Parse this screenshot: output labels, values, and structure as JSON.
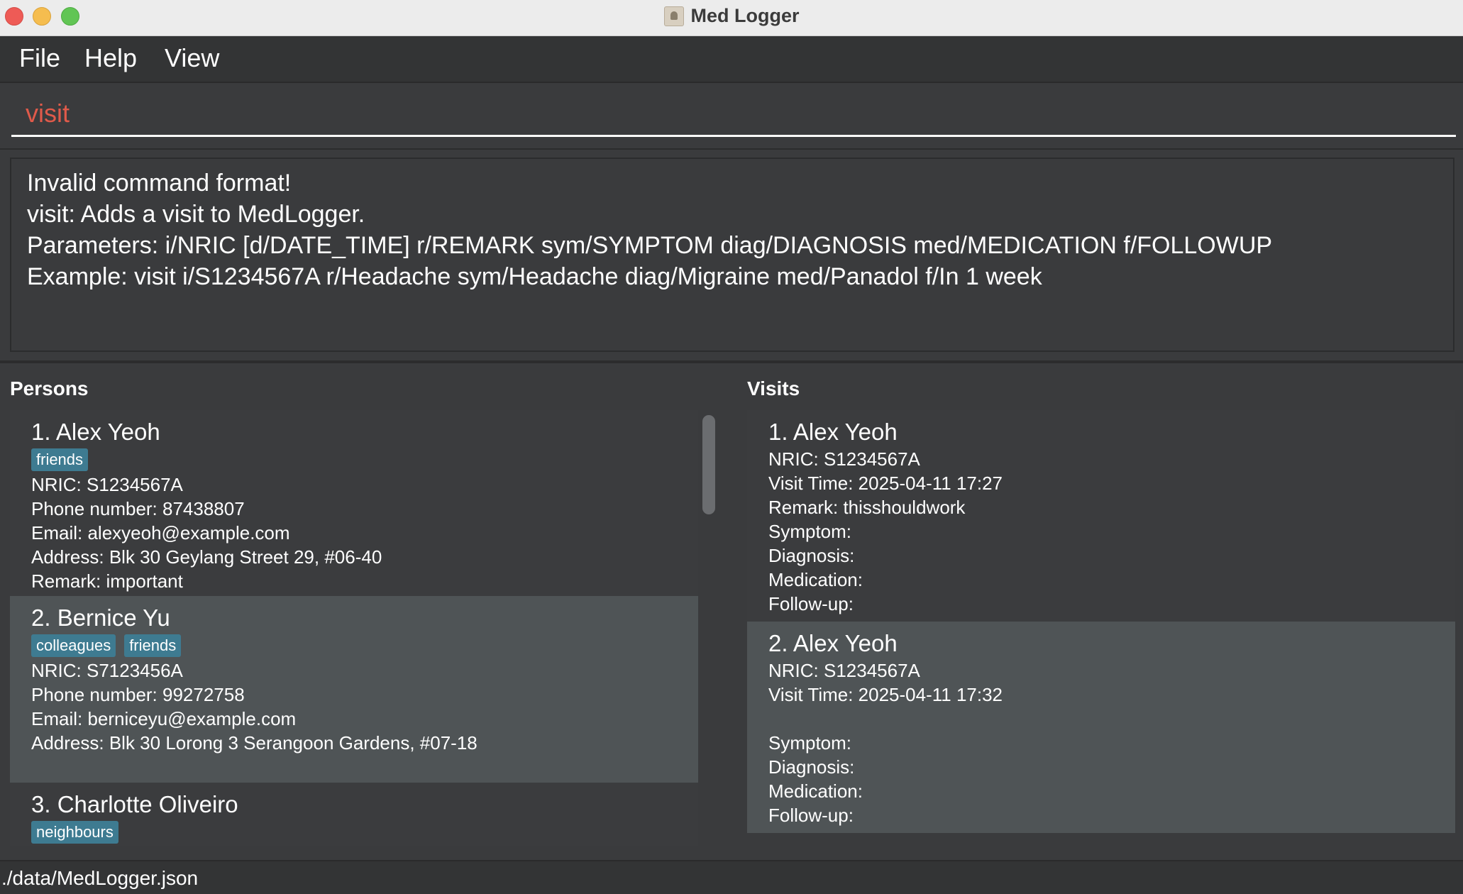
{
  "window": {
    "title": "Med Logger"
  },
  "menu": [
    "File",
    "Help",
    "View"
  ],
  "command": {
    "value": "visit"
  },
  "result": {
    "lines": [
      "Invalid command format!",
      "visit: Adds a visit to MedLogger.",
      "Parameters: i/NRIC [d/DATE_TIME] r/REMARK sym/SYMPTOM diag/DIAGNOSIS med/MEDICATION f/FOLLOWUP",
      "Example: visit i/S1234567A r/Headache sym/Headache diag/Migraine med/Panadol f/In 1 week"
    ]
  },
  "persons": {
    "title": "Persons",
    "items": [
      {
        "name": "1. Alex Yeoh",
        "tags": [
          "friends"
        ],
        "nric": "NRIC: S1234567A",
        "phone": "Phone number: 87438807",
        "email": "Email: alexyeoh@example.com",
        "address": "Address: Blk 30 Geylang Street 29, #06-40",
        "remark": "Remark: important"
      },
      {
        "name": "2. Bernice Yu",
        "tags": [
          "colleagues",
          "friends"
        ],
        "nric": "NRIC: S7123456A",
        "phone": "Phone number: 99272758",
        "email": "Email: berniceyu@example.com",
        "address": "Address: Blk 30 Lorong 3 Serangoon Gardens, #07-18"
      },
      {
        "name": "3. Charlotte Oliveiro",
        "tags": [
          "neighbours"
        ]
      }
    ]
  },
  "visits": {
    "title": "Visits",
    "items": [
      {
        "name": "1. Alex Yeoh",
        "nric": "NRIC: S1234567A",
        "time": "Visit Time: 2025-04-11 17:27",
        "remark": "Remark: thisshouldwork",
        "symptom": "Symptom:",
        "diagnosis": "Diagnosis:",
        "medication": "Medication:",
        "followup": "Follow-up:"
      },
      {
        "name": "2. Alex Yeoh",
        "nric": "NRIC: S1234567A",
        "time": "Visit Time: 2025-04-11 17:32",
        "symptom": "Symptom:",
        "diagnosis": "Diagnosis:",
        "medication": "Medication:",
        "followup": "Follow-up:"
      }
    ]
  },
  "status": {
    "path": "./data/MedLogger.json"
  },
  "colors": {
    "background": "#3a3b3d",
    "card_dark": "#3b3c3e",
    "card_light": "#4f5456",
    "tag": "#3e7b91",
    "command_text": "#e05a4a"
  }
}
